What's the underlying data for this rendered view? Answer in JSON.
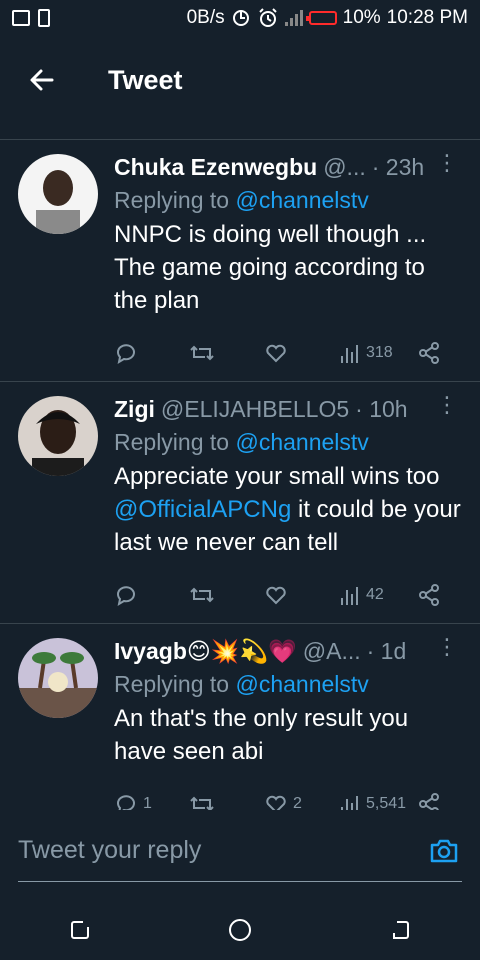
{
  "status_bar": {
    "speed": "0B/s",
    "battery": "10%",
    "time": "10:28 PM"
  },
  "header": {
    "title": "Tweet"
  },
  "tweets": [
    {
      "name": "Chuka Ezenwegbu",
      "handle": "@...",
      "time": "· 23h",
      "replying_prefix": "Replying to ",
      "replying_to": "@channelstv",
      "text": "NNPC is doing well though ... The game going according to the plan",
      "mention_text": "",
      "text_after": "",
      "reply_count": "",
      "retweet_count": "",
      "like_count": "",
      "view_count": "318"
    },
    {
      "name": "Zigi",
      "handle": "@ELIJAHBELLO5",
      "time": "· 10h",
      "replying_prefix": "Replying to ",
      "replying_to": "@channelstv",
      "text": "Appreciate your small wins too ",
      "mention_text": "@OfficialAPCNg",
      "text_after": " it could be your last we never can tell",
      "reply_count": "",
      "retweet_count": "",
      "like_count": "",
      "view_count": "42"
    },
    {
      "name": "Ivyagb😊💥💫💗",
      "handle": "@A...",
      "time": "· 1d",
      "replying_prefix": "Replying to ",
      "replying_to": "@channelstv",
      "text": "An that's the only result you have seen abi",
      "mention_text": "",
      "text_after": "",
      "reply_count": "1",
      "retweet_count": "",
      "like_count": "2",
      "view_count": "5,541"
    }
  ],
  "reply": {
    "placeholder": "Tweet your reply"
  },
  "colors": {
    "background": "#15202b",
    "accent": "#1da1f2",
    "muted": "#8899a6",
    "divider": "#38444d"
  }
}
